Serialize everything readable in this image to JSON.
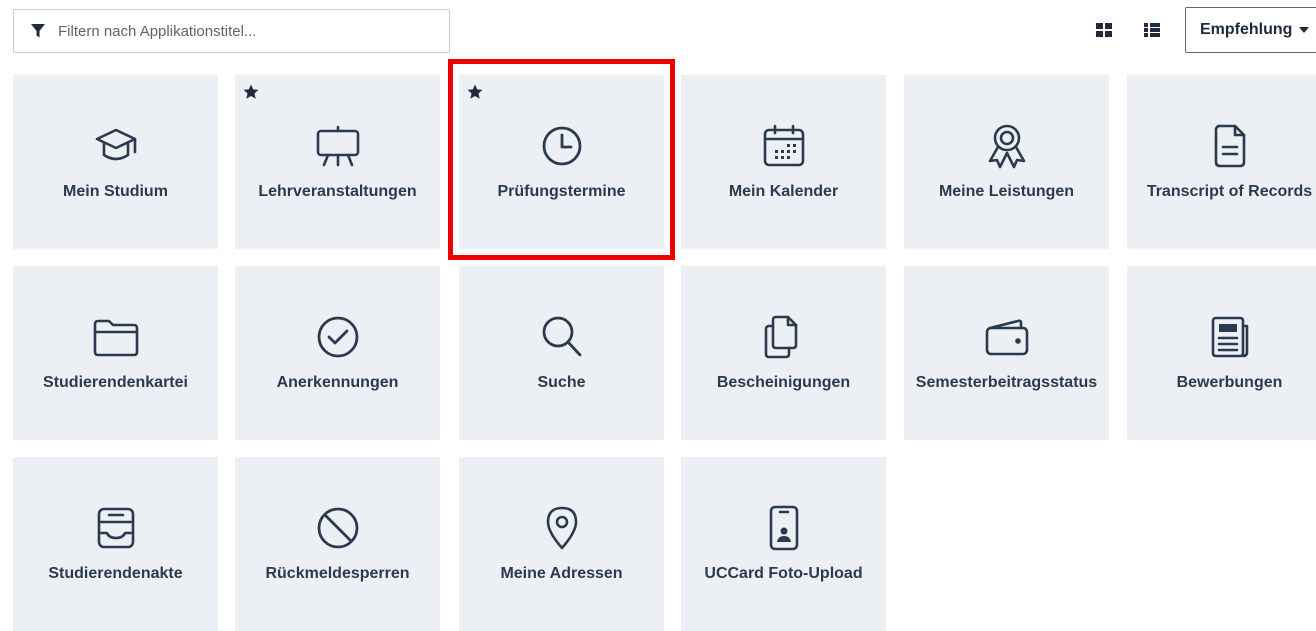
{
  "filter": {
    "placeholder": "Filtern nach Applikationstitel...",
    "icon": "filter-icon"
  },
  "view_toggle": {
    "grid_icon": "grid-view-icon",
    "list_icon": "list-view-icon"
  },
  "sort": {
    "label": "Empfehlung",
    "icon": "caret-down-icon"
  },
  "colors": {
    "tile_background": "#ecf0f4",
    "text": "#2b3a4e",
    "highlight_border": "#ee0000"
  },
  "tiles": [
    {
      "label": "Mein Studium",
      "icon": "graduation-cap-icon",
      "favorite": false
    },
    {
      "label": "Lehrveranstaltungen",
      "icon": "easel-icon",
      "favorite": true
    },
    {
      "label": "Prüfungstermine",
      "icon": "clock-icon",
      "favorite": true,
      "highlighted": true
    },
    {
      "label": "Mein Kalender",
      "icon": "calendar-icon",
      "favorite": false
    },
    {
      "label": "Meine Leistungen",
      "icon": "award-ribbon-icon",
      "favorite": false
    },
    {
      "label": "Transcript of Records",
      "icon": "document-icon",
      "favorite": false
    },
    {
      "label": "Studierendenkartei",
      "icon": "folder-icon",
      "favorite": false
    },
    {
      "label": "Anerkennungen",
      "icon": "check-circle-icon",
      "favorite": false
    },
    {
      "label": "Suche",
      "icon": "search-icon",
      "favorite": false
    },
    {
      "label": "Bescheinigungen",
      "icon": "copy-documents-icon",
      "favorite": false
    },
    {
      "label": "Semesterbeitragsstatus",
      "icon": "wallet-icon",
      "favorite": false
    },
    {
      "label": "Bewerbungen",
      "icon": "newspaper-icon",
      "favorite": false
    },
    {
      "label": "Studierendenakte",
      "icon": "archive-box-icon",
      "favorite": false
    },
    {
      "label": "Rückmeldesperren",
      "icon": "ban-icon",
      "favorite": false
    },
    {
      "label": "Meine Adressen",
      "icon": "map-pin-icon",
      "favorite": false
    },
    {
      "label": "UCCard Foto-Upload",
      "icon": "id-card-icon",
      "favorite": false
    }
  ]
}
